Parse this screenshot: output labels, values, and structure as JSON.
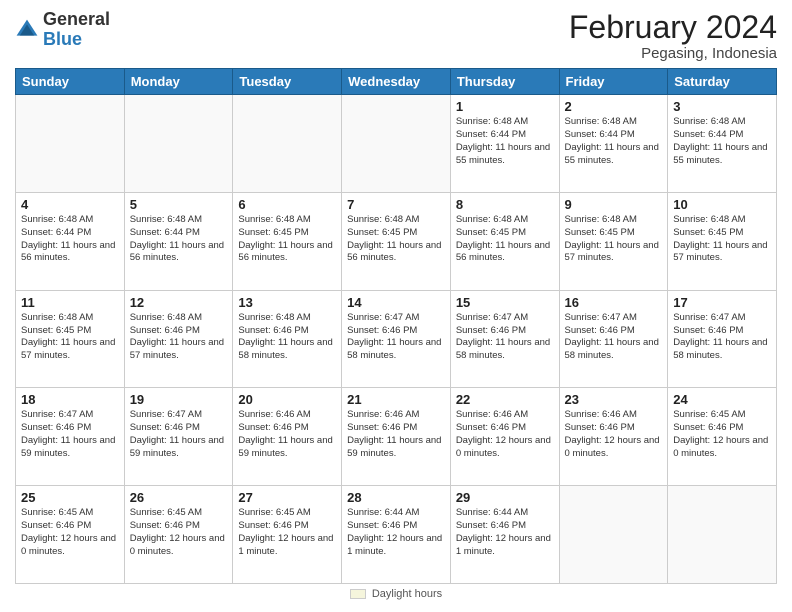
{
  "header": {
    "logo": {
      "general": "General",
      "blue": "Blue"
    },
    "title": "February 2024",
    "location": "Pegasing, Indonesia"
  },
  "days_of_week": [
    "Sunday",
    "Monday",
    "Tuesday",
    "Wednesday",
    "Thursday",
    "Friday",
    "Saturday"
  ],
  "weeks": [
    [
      {
        "day": "",
        "info": ""
      },
      {
        "day": "",
        "info": ""
      },
      {
        "day": "",
        "info": ""
      },
      {
        "day": "",
        "info": ""
      },
      {
        "day": "1",
        "info": "Sunrise: 6:48 AM\nSunset: 6:44 PM\nDaylight: 11 hours and 55 minutes."
      },
      {
        "day": "2",
        "info": "Sunrise: 6:48 AM\nSunset: 6:44 PM\nDaylight: 11 hours and 55 minutes."
      },
      {
        "day": "3",
        "info": "Sunrise: 6:48 AM\nSunset: 6:44 PM\nDaylight: 11 hours and 55 minutes."
      }
    ],
    [
      {
        "day": "4",
        "info": "Sunrise: 6:48 AM\nSunset: 6:44 PM\nDaylight: 11 hours and 56 minutes."
      },
      {
        "day": "5",
        "info": "Sunrise: 6:48 AM\nSunset: 6:44 PM\nDaylight: 11 hours and 56 minutes."
      },
      {
        "day": "6",
        "info": "Sunrise: 6:48 AM\nSunset: 6:45 PM\nDaylight: 11 hours and 56 minutes."
      },
      {
        "day": "7",
        "info": "Sunrise: 6:48 AM\nSunset: 6:45 PM\nDaylight: 11 hours and 56 minutes."
      },
      {
        "day": "8",
        "info": "Sunrise: 6:48 AM\nSunset: 6:45 PM\nDaylight: 11 hours and 56 minutes."
      },
      {
        "day": "9",
        "info": "Sunrise: 6:48 AM\nSunset: 6:45 PM\nDaylight: 11 hours and 57 minutes."
      },
      {
        "day": "10",
        "info": "Sunrise: 6:48 AM\nSunset: 6:45 PM\nDaylight: 11 hours and 57 minutes."
      }
    ],
    [
      {
        "day": "11",
        "info": "Sunrise: 6:48 AM\nSunset: 6:45 PM\nDaylight: 11 hours and 57 minutes."
      },
      {
        "day": "12",
        "info": "Sunrise: 6:48 AM\nSunset: 6:46 PM\nDaylight: 11 hours and 57 minutes."
      },
      {
        "day": "13",
        "info": "Sunrise: 6:48 AM\nSunset: 6:46 PM\nDaylight: 11 hours and 58 minutes."
      },
      {
        "day": "14",
        "info": "Sunrise: 6:47 AM\nSunset: 6:46 PM\nDaylight: 11 hours and 58 minutes."
      },
      {
        "day": "15",
        "info": "Sunrise: 6:47 AM\nSunset: 6:46 PM\nDaylight: 11 hours and 58 minutes."
      },
      {
        "day": "16",
        "info": "Sunrise: 6:47 AM\nSunset: 6:46 PM\nDaylight: 11 hours and 58 minutes."
      },
      {
        "day": "17",
        "info": "Sunrise: 6:47 AM\nSunset: 6:46 PM\nDaylight: 11 hours and 58 minutes."
      }
    ],
    [
      {
        "day": "18",
        "info": "Sunrise: 6:47 AM\nSunset: 6:46 PM\nDaylight: 11 hours and 59 minutes."
      },
      {
        "day": "19",
        "info": "Sunrise: 6:47 AM\nSunset: 6:46 PM\nDaylight: 11 hours and 59 minutes."
      },
      {
        "day": "20",
        "info": "Sunrise: 6:46 AM\nSunset: 6:46 PM\nDaylight: 11 hours and 59 minutes."
      },
      {
        "day": "21",
        "info": "Sunrise: 6:46 AM\nSunset: 6:46 PM\nDaylight: 11 hours and 59 minutes."
      },
      {
        "day": "22",
        "info": "Sunrise: 6:46 AM\nSunset: 6:46 PM\nDaylight: 12 hours and 0 minutes."
      },
      {
        "day": "23",
        "info": "Sunrise: 6:46 AM\nSunset: 6:46 PM\nDaylight: 12 hours and 0 minutes."
      },
      {
        "day": "24",
        "info": "Sunrise: 6:45 AM\nSunset: 6:46 PM\nDaylight: 12 hours and 0 minutes."
      }
    ],
    [
      {
        "day": "25",
        "info": "Sunrise: 6:45 AM\nSunset: 6:46 PM\nDaylight: 12 hours and 0 minutes."
      },
      {
        "day": "26",
        "info": "Sunrise: 6:45 AM\nSunset: 6:46 PM\nDaylight: 12 hours and 0 minutes."
      },
      {
        "day": "27",
        "info": "Sunrise: 6:45 AM\nSunset: 6:46 PM\nDaylight: 12 hours and 1 minute."
      },
      {
        "day": "28",
        "info": "Sunrise: 6:44 AM\nSunset: 6:46 PM\nDaylight: 12 hours and 1 minute."
      },
      {
        "day": "29",
        "info": "Sunrise: 6:44 AM\nSunset: 6:46 PM\nDaylight: 12 hours and 1 minute."
      },
      {
        "day": "",
        "info": ""
      },
      {
        "day": "",
        "info": ""
      }
    ]
  ],
  "footer": {
    "daylight_label": "Daylight hours"
  }
}
